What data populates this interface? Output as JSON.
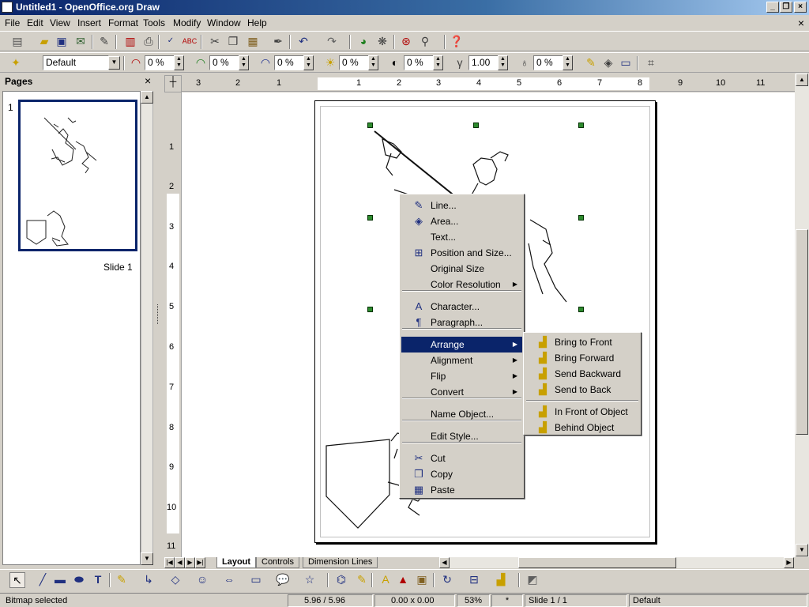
{
  "window": {
    "title": "Untitled1 - OpenOffice.org Draw",
    "controls": [
      "_",
      "❐",
      "×"
    ]
  },
  "menubar": [
    "File",
    "Edit",
    "View",
    "Insert",
    "Format",
    "Tools",
    "Modify",
    "Window",
    "Help"
  ],
  "doc_close": "×",
  "line_toolbar": {
    "style_value": "Default",
    "fields": [
      "0 %",
      "0 %",
      "0 %",
      "0 %",
      "0 %",
      "1.00",
      "0 %"
    ]
  },
  "pages_panel": {
    "title": "Pages",
    "close": "×",
    "slide_number": "1",
    "slide_label": "Slide 1"
  },
  "hruler_labels": [
    "3",
    "2",
    "1",
    "1",
    "2",
    "3",
    "4",
    "5",
    "6",
    "7",
    "8",
    "9",
    "10",
    "11"
  ],
  "vruler_labels": [
    "1",
    "2",
    "3",
    "4",
    "5",
    "6",
    "7",
    "8",
    "9",
    "10",
    "11"
  ],
  "tabs": [
    "Layout",
    "Controls",
    "Dimension Lines"
  ],
  "status": {
    "message": "Bitmap selected",
    "position": "5.96 / 5.96",
    "size": "0.00 x 0.00",
    "zoom": "53%",
    "modified": "*",
    "slide": "Slide 1 / 1",
    "layout": "Default"
  },
  "context_menu": {
    "items": [
      "Line...",
      "Area...",
      "Text...",
      "Position and Size...",
      "Original Size",
      "Color Resolution",
      "Character...",
      "Paragraph...",
      "Arrange",
      "Alignment",
      "Flip",
      "Convert",
      "Name Object...",
      "Edit Style...",
      "Cut",
      "Copy",
      "Paste"
    ],
    "highlighted": "Arrange"
  },
  "arrange_submenu": {
    "items": [
      "Bring to Front",
      "Bring Forward",
      "Send Backward",
      "Send to Back",
      "In Front of Object",
      "Behind Object"
    ]
  },
  "icons": {
    "context": [
      "line-icon",
      "area-icon",
      "",
      "position-size-icon",
      "",
      "",
      "character-icon",
      "paragraph-icon",
      "",
      "",
      "",
      "",
      "",
      "",
      "cut-icon",
      "copy-icon",
      "paste-icon"
    ],
    "submenu": [
      "bring-to-front-icon",
      "bring-forward-icon",
      "send-backward-icon",
      "send-to-back-icon",
      "in-front-of-object-icon",
      "behind-object-icon"
    ]
  },
  "colors": {
    "title_bar": "#0a246a",
    "menu_highlight": "#0a246a",
    "selection_handle": "#2e8b2e"
  }
}
